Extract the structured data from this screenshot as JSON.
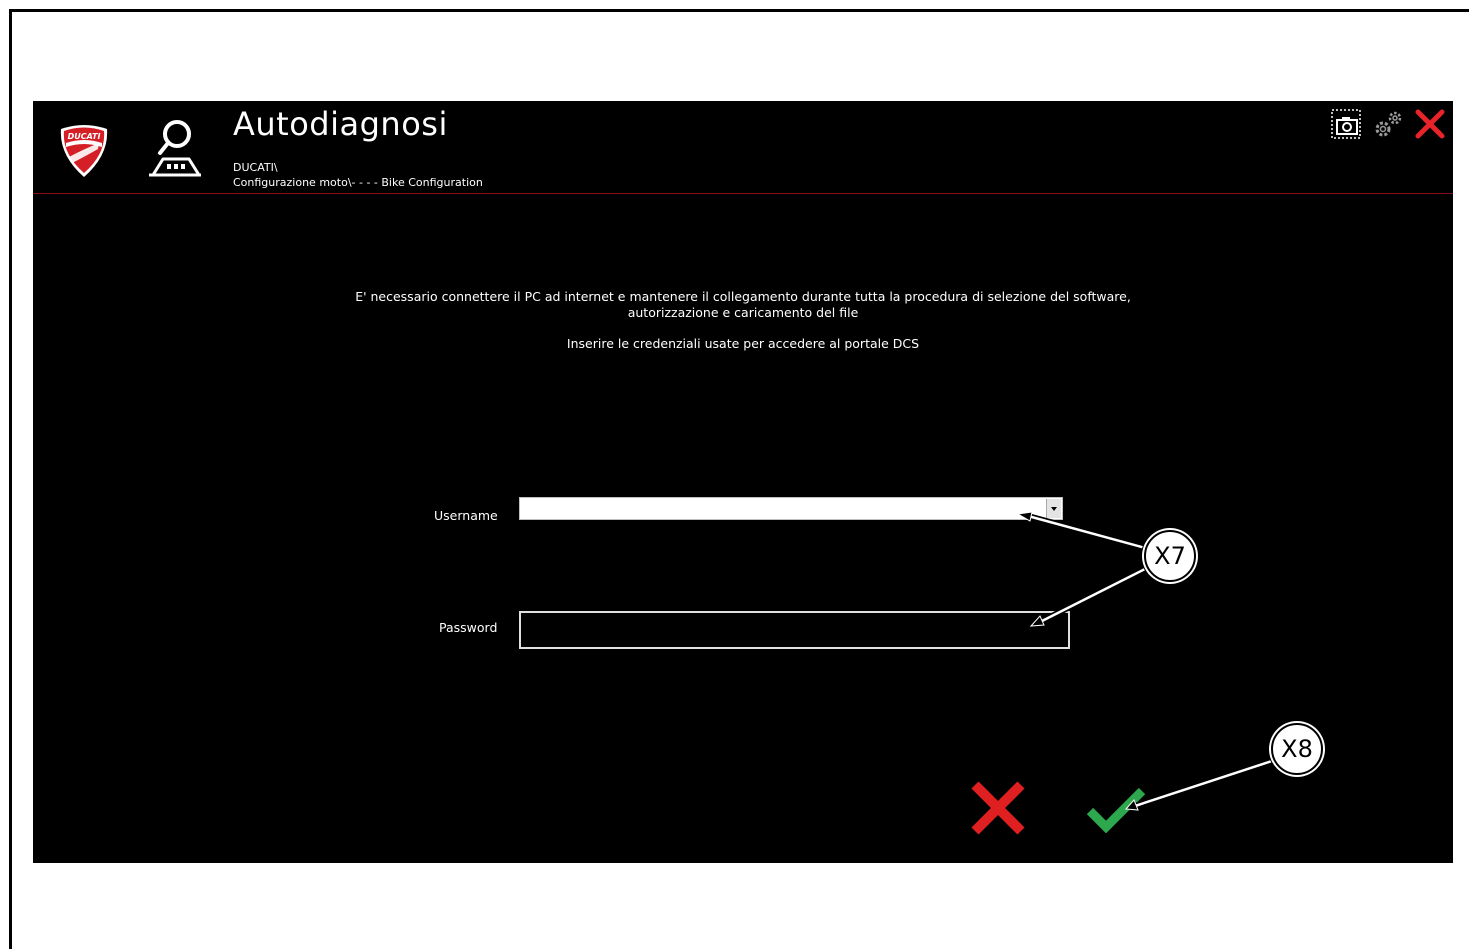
{
  "app": {
    "title": "Autodiagnosi",
    "breadcrumb_line1": "DUCATI\\",
    "breadcrumb_line2": "Configurazione moto\\- - - - Bike Configuration"
  },
  "logo": {
    "text": "DUCATI",
    "color": "#d51f26"
  },
  "toolbar": {
    "icons": [
      "screenshot-icon",
      "settings-gears-icon",
      "close-icon"
    ]
  },
  "content": {
    "message_line1": "E' necessario connettere il PC ad internet e mantenere il collegamento durante tutta la procedura di selezione del software,",
    "message_line2": "autorizzazione e caricamento del file",
    "message_line3": "Inserire le credenziali usate per accedere al portale DCS"
  },
  "form": {
    "username_label": "Username",
    "username_value": "",
    "password_label": "Password",
    "password_value": ""
  },
  "actions": {
    "cancel_color": "#e02020",
    "confirm_color": "#2ea84e"
  },
  "callouts": {
    "x7": "X7",
    "x8": "X8"
  }
}
